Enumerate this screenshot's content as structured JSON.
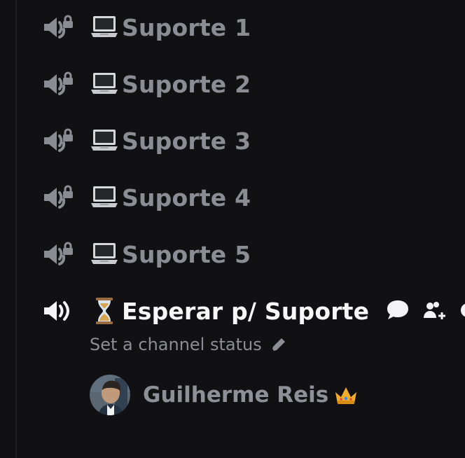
{
  "channels": [
    {
      "name": "Suporte 1",
      "locked": true,
      "emoji_icon": "laptop-icon",
      "active": false
    },
    {
      "name": "Suporte 2",
      "locked": true,
      "emoji_icon": "laptop-icon",
      "active": false
    },
    {
      "name": "Suporte 3",
      "locked": true,
      "emoji_icon": "laptop-icon",
      "active": false
    },
    {
      "name": "Suporte 4",
      "locked": true,
      "emoji_icon": "laptop-icon",
      "active": false
    },
    {
      "name": "Suporte 5",
      "locked": true,
      "emoji_icon": "laptop-icon",
      "active": false
    },
    {
      "name": "Esperar p/ Suporte",
      "locked": false,
      "emoji_icon": "hourglass-icon",
      "active": true
    }
  ],
  "active_channel": {
    "status_placeholder": "Set a channel status",
    "actions": [
      "chat-icon",
      "add-user-icon",
      "settings-icon"
    ]
  },
  "member": {
    "name": "Guilherme Reis",
    "badge_icon": "crown-icon"
  },
  "colors": {
    "background": "#111114",
    "muted_text": "#8c8d94",
    "active_text": "#f7f7f8"
  }
}
